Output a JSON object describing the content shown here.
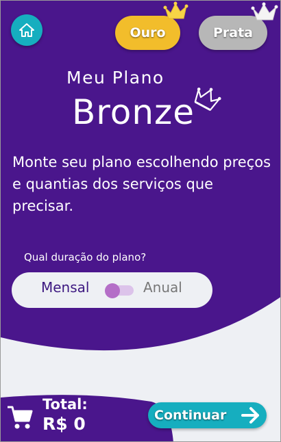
{
  "header": {
    "home_icon": "home-icon",
    "plan_options": [
      {
        "label": "Ouro",
        "color": "#f2bd2b",
        "crown_icon": "crown-icon"
      },
      {
        "label": "Prata",
        "color": "#b7b7b7",
        "crown_icon": "crown-icon"
      }
    ]
  },
  "plan": {
    "subtitle": "Meu Plano",
    "name": "Bronze",
    "crown_icon": "crown-icon"
  },
  "intro": {
    "text": "Monte seu plano escolhendo preços e quantias dos serviços que precisar."
  },
  "duration": {
    "question": "Qual duração do plano?",
    "option_monthly": "Mensal",
    "option_yearly": "Anual",
    "selected": "Mensal"
  },
  "footer": {
    "cart_icon": "cart-icon",
    "total_label": "Total:",
    "total_value": "R$ 0",
    "continue_label": "Continuar",
    "arrow_icon": "arrow-right-icon"
  },
  "colors": {
    "primary": "#4a168c",
    "accent": "#16aebf",
    "gold": "#f2bd2b",
    "silver": "#b7b7b7",
    "background": "#eef0f4"
  }
}
